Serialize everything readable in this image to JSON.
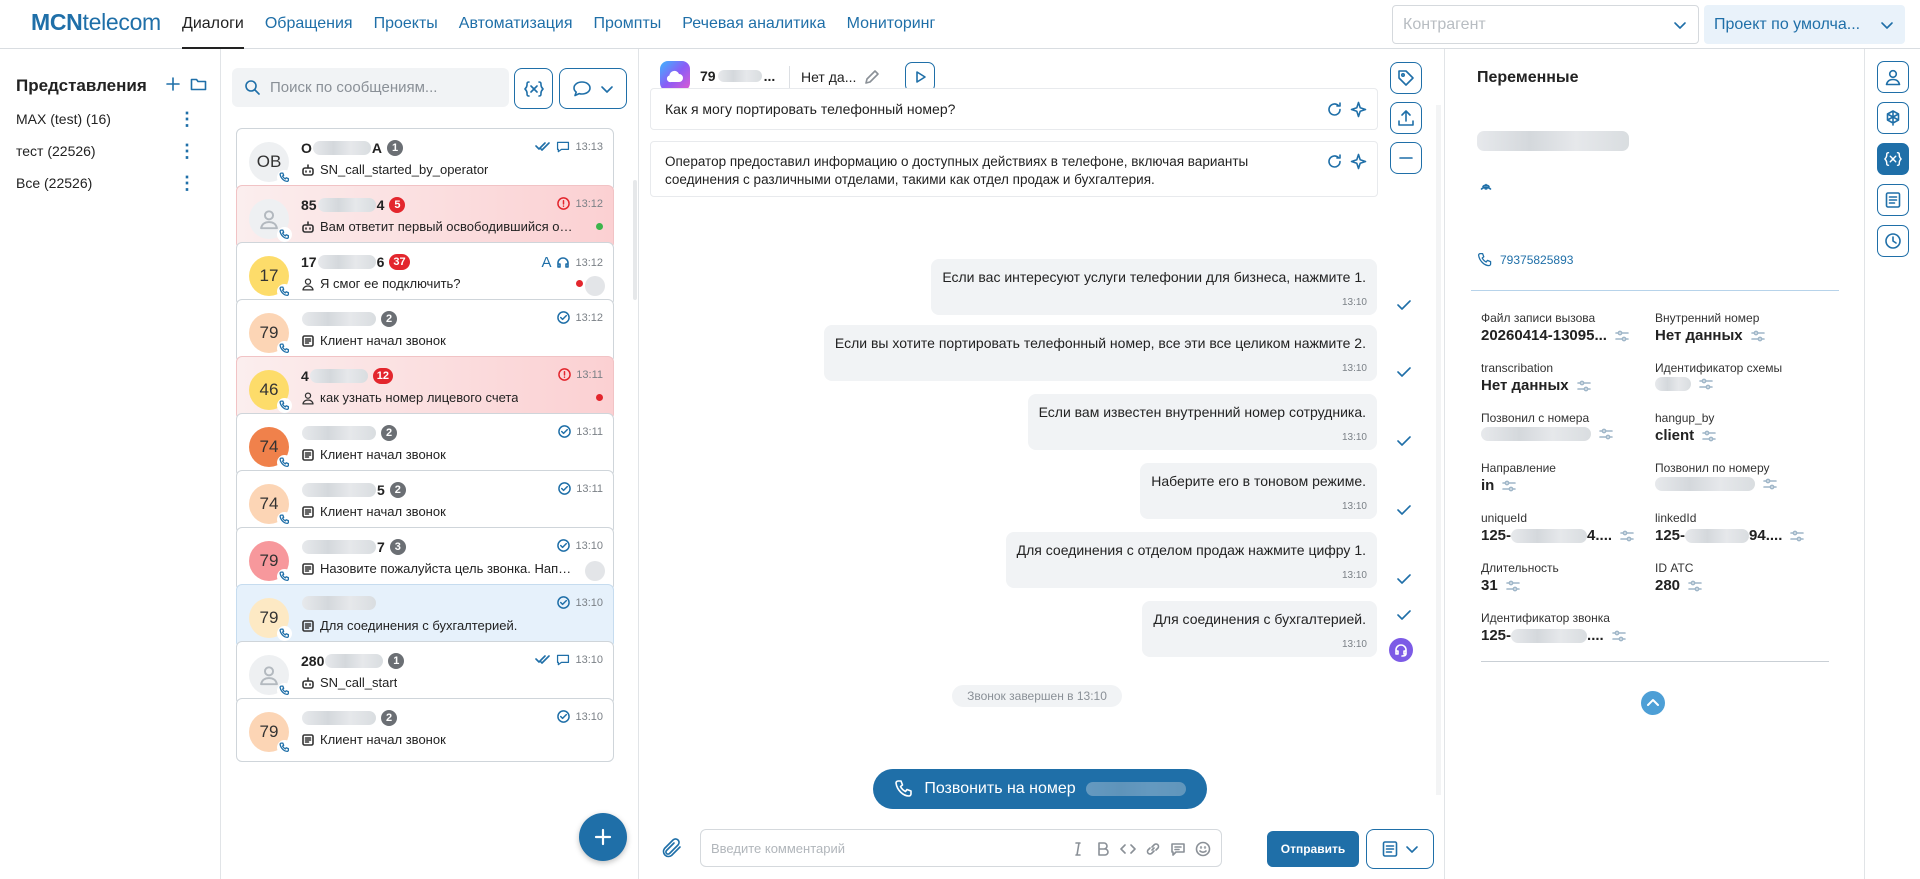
{
  "brand": {
    "logo_bold": "MCN",
    "logo_rest": "telecom"
  },
  "nav": [
    "Диалоги",
    "Обращения",
    "Проекты",
    "Автоматизация",
    "Промпты",
    "Речевая аналитика",
    "Мониторинг"
  ],
  "nav_active": "Диалоги",
  "counterparty_placeholder": "Контрагент",
  "project_select": "Проект по умолча...",
  "views": {
    "title": "Представления",
    "items": [
      "MAX (test)  (16)",
      "тест  (22526)",
      "Все  (22526)"
    ]
  },
  "search": {
    "placeholder": "Поиск по сообщениям..."
  },
  "dialogs": [
    {
      "avatar": "ОВ",
      "name": "О",
      "name_end": "А",
      "badge": "1",
      "time": "13:13",
      "message": "SN_call_started_by_operator",
      "style": "normal",
      "avatar_color": "#eef0f2"
    },
    {
      "avatar": "",
      "name": "85",
      "name_end": "4",
      "badge": "5",
      "time": "13:12",
      "message": "Вам ответит первый освободившийся оператор",
      "style": "red",
      "avatar_color": "#eef0f2"
    },
    {
      "avatar": "17",
      "name": "17",
      "name_end": "6",
      "badge": "37",
      "time": "13:12",
      "message": "Я смог ее подключить?",
      "style": "normal",
      "avatar_color": "#fddc6a"
    },
    {
      "avatar": "79",
      "name": "",
      "name_end": "",
      "badge": "2",
      "time": "13:12",
      "message": "Клиент начал звонок",
      "style": "normal",
      "avatar_color": "#fcd5b5"
    },
    {
      "avatar": "46",
      "name": "4",
      "name_end": "",
      "badge": "12",
      "time": "13:11",
      "message": "как узнать номер лицевого счета",
      "style": "red",
      "avatar_color": "#fddc6a"
    },
    {
      "avatar": "74",
      "name": "",
      "name_end": "",
      "badge": "2",
      "time": "13:11",
      "message": "Клиент начал звонок",
      "style": "normal",
      "avatar_color": "#f0814b"
    },
    {
      "avatar": "74",
      "name": "",
      "name_end": "5",
      "badge": "2",
      "time": "13:11",
      "message": "Клиент начал звонок",
      "style": "normal",
      "avatar_color": "#fcd5b5"
    },
    {
      "avatar": "79",
      "name": "",
      "name_end": "7",
      "badge": "3",
      "time": "13:10",
      "message": "Назовите пожалуйста цель звонка. Например, оплата услуг",
      "style": "normal",
      "avatar_color": "#f7989c"
    },
    {
      "avatar": "79",
      "name": "",
      "name_end": "",
      "badge": "",
      "time": "13:10",
      "message": "Для соединения с бухгалтерией.",
      "style": "selected",
      "avatar_color": "#fde9c4"
    },
    {
      "avatar": "",
      "name": "280",
      "name_end": "",
      "badge": "1",
      "time": "13:10",
      "message": "SN_call_start",
      "style": "normal",
      "avatar_color": "#eef0f2"
    },
    {
      "avatar": "79",
      "name": "",
      "name_end": "",
      "badge": "2",
      "time": "13:10",
      "message": "Клиент начал звонок",
      "style": "normal",
      "avatar_color": "#fcd5b5"
    }
  ],
  "chat": {
    "contact_prefix": "79",
    "status": "Нет да...",
    "summaries": [
      "Как я могу портировать телефонный номер?",
      "Оператор предоставил информацию о доступных действиях в телефоне, включая варианты соединения с различными отделами, такими как отдел продаж и бухгалтерия."
    ],
    "messages": [
      {
        "text": "Если вас интересуют услуги телефонии для бизнеса, нажмите 1.",
        "time": "13:10"
      },
      {
        "text": "Если вы хотите портировать телефонный номер, все эти все целиком нажмите 2.",
        "time": "13:10"
      },
      {
        "text": "Если вам известен внутренний номер сотрудника.",
        "time": "13:10"
      },
      {
        "text": "Наберите его в тоновом режиме.",
        "time": "13:10"
      },
      {
        "text": "Для соединения с отделом продаж нажмите цифру 1.",
        "time": "13:10"
      },
      {
        "text": "Для соединения с бухгалтерией.",
        "time": "13:10"
      }
    ],
    "call_ended": "Звонок завершен в 13:10",
    "call_button": "Позвонить на номер",
    "comment_placeholder": "Введите комментарий",
    "send": "Отправить"
  },
  "variables": {
    "title": "Переменные",
    "phone": "79375825893",
    "fields": [
      {
        "label": "Файл записи вызова",
        "value": "20260414-13095..."
      },
      {
        "label": "Внутренний номер",
        "value": "Нет данных"
      },
      {
        "label": "transcribation",
        "value": "Нет данных"
      },
      {
        "label": "Идентификатор схемы",
        "value": ""
      },
      {
        "label": "Позвонил с номера",
        "value": ""
      },
      {
        "label": "hangup_by",
        "value": "client"
      },
      {
        "label": "Направление",
        "value": "in"
      },
      {
        "label": "Позвонил по номеру",
        "value": ""
      },
      {
        "label": "uniqueId",
        "value": "125-"
      },
      {
        "label": "linkedId",
        "value": "125-"
      },
      {
        "label": "Длительность",
        "value": "31"
      },
      {
        "label": "ID АТС",
        "value": "280"
      },
      {
        "label": "Идентификатор звонка",
        "value": "125-"
      }
    ],
    "suffixes": {
      "uniqueId": "4....",
      "linkedId": "94....",
      "call_id": "...."
    }
  },
  "colors": {
    "accent": "#1f6fa8",
    "danger": "#e3262d",
    "online": "#3cb44b"
  }
}
